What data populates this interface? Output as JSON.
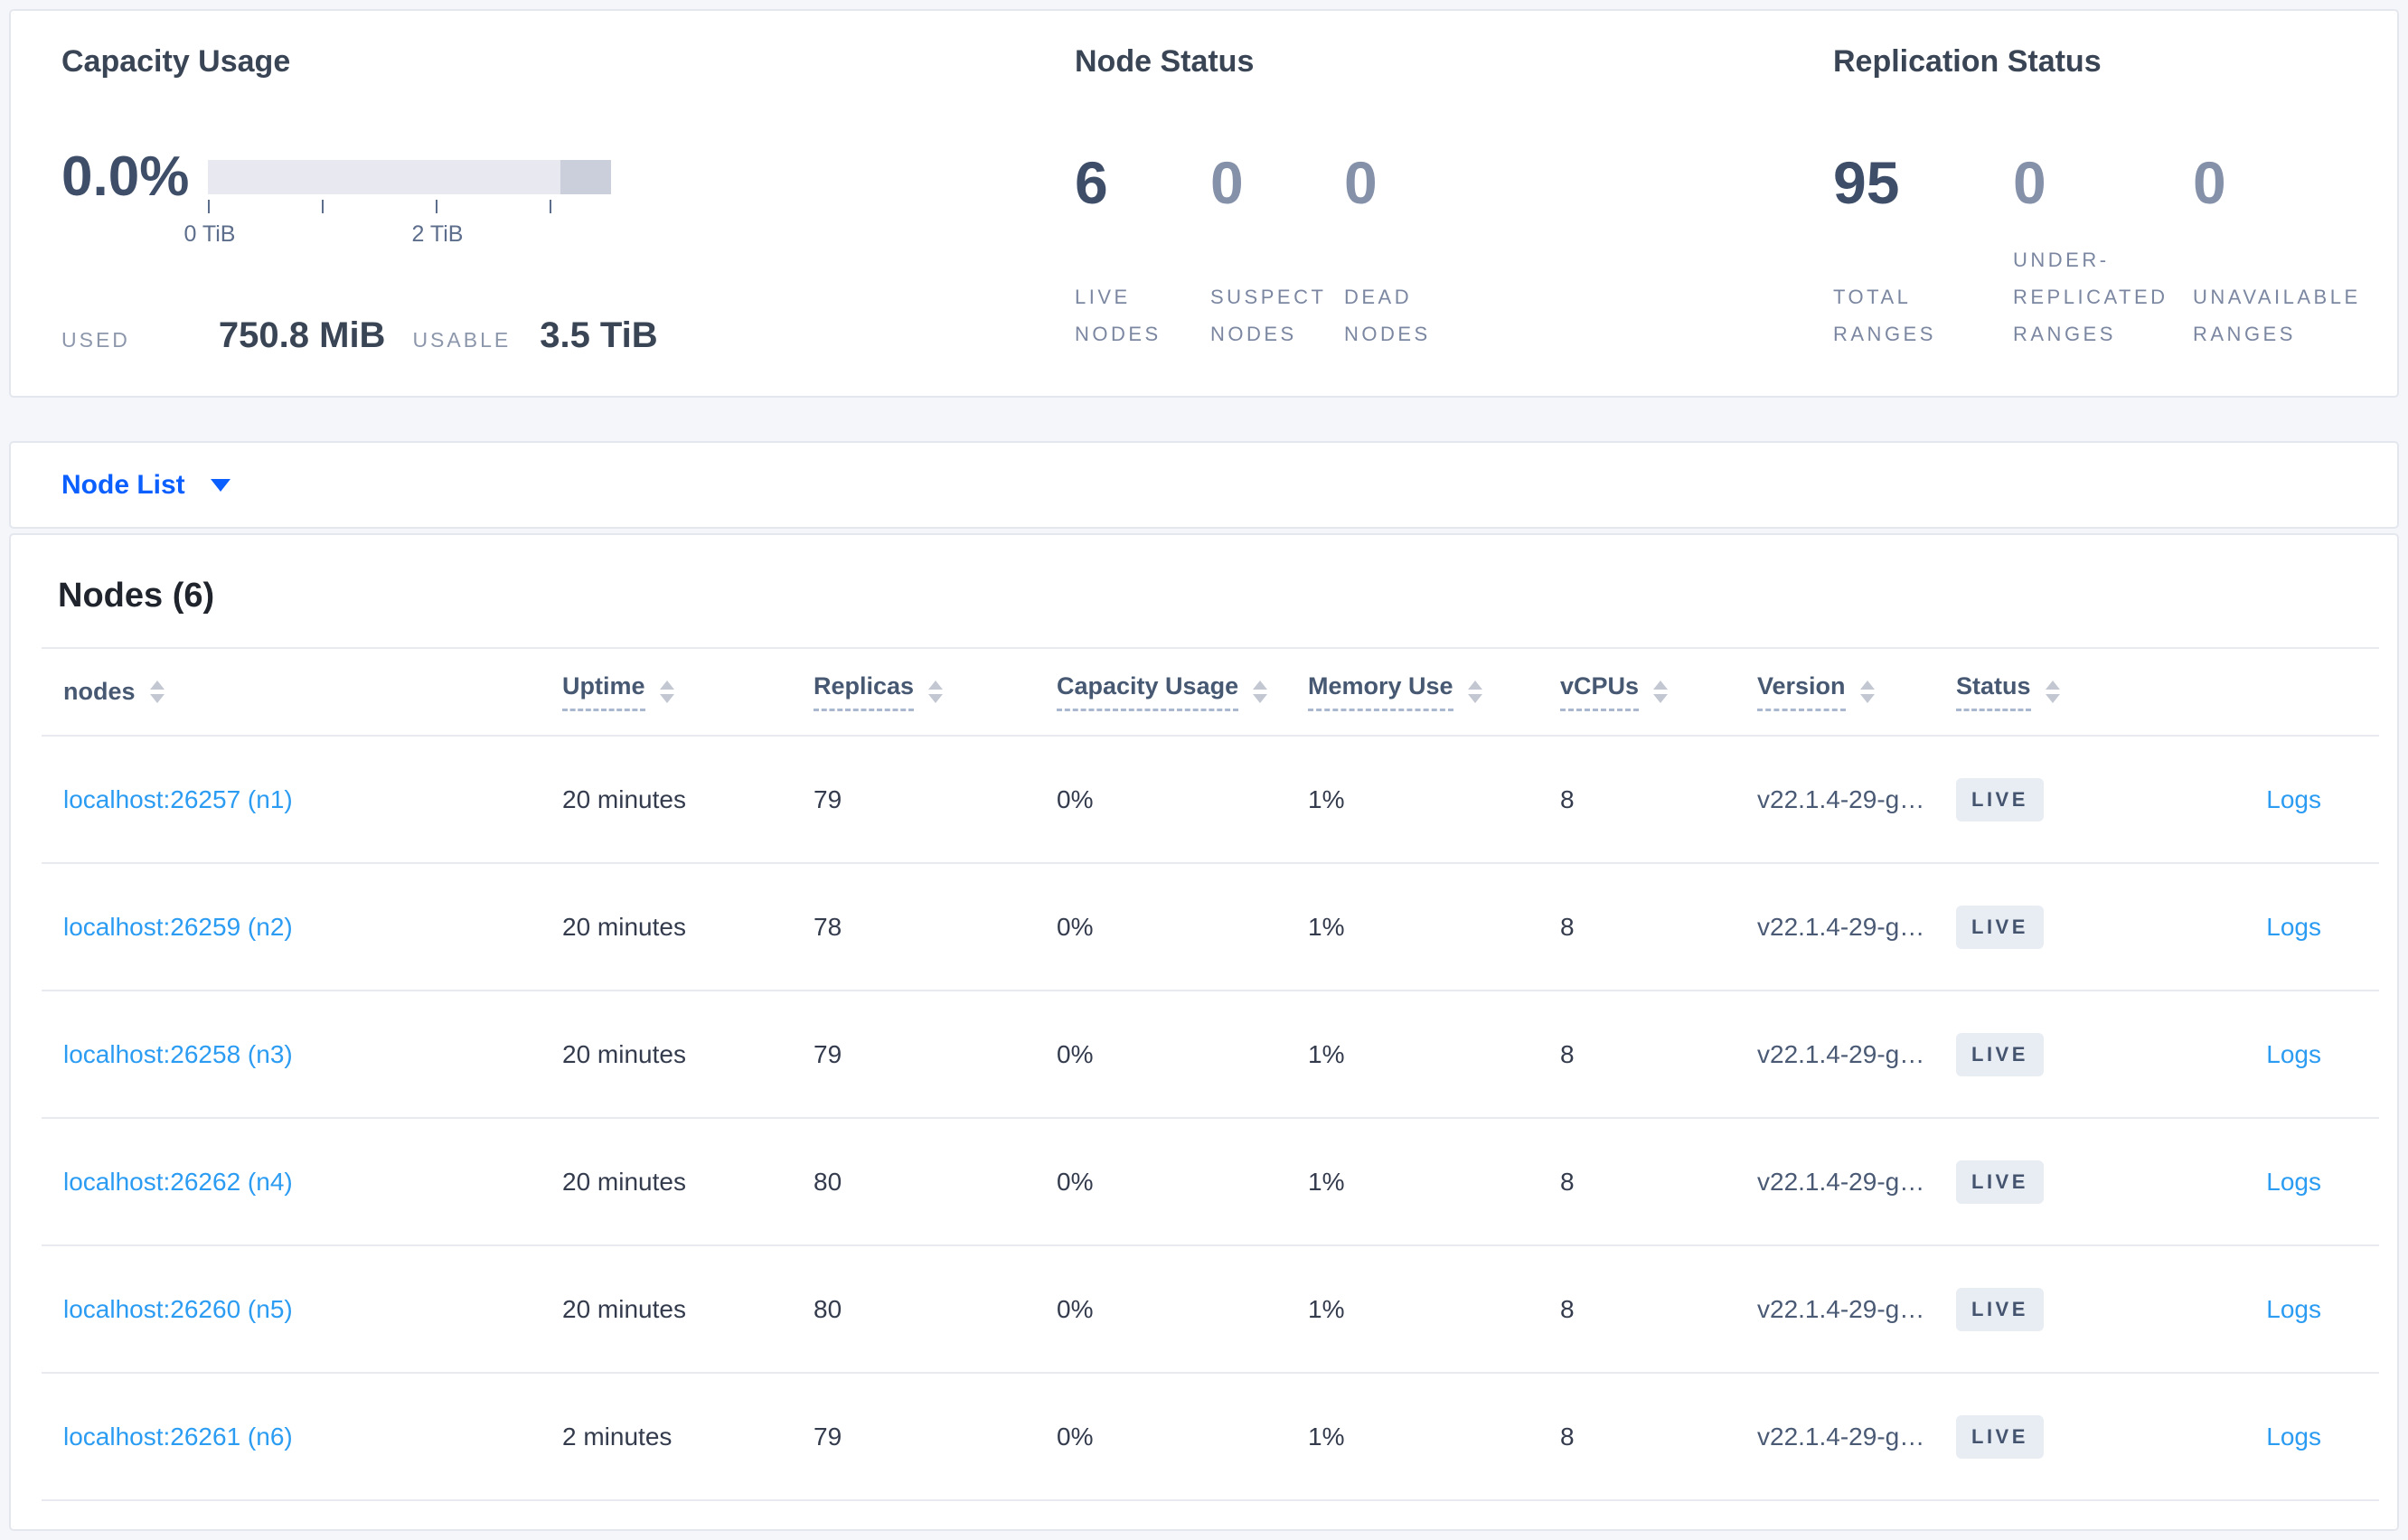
{
  "theme": {
    "page_bg": "#f4f6fa",
    "primary_blue": "#0b5fff",
    "link_blue": "#2b9cf2",
    "badge_bg": "#e8ecf3",
    "badge_text": "#44536e",
    "bar_track": "#e7e8f0",
    "bar_cap": "#cbcfdc"
  },
  "summary": {
    "capacity": {
      "title": "Capacity Usage",
      "percent": "0.0%",
      "axis_ticks": [
        "0 TiB",
        "2 TiB"
      ],
      "used_label": "USED",
      "used_value": "750.8 MiB",
      "usable_label": "USABLE",
      "usable_value": "3.5 TiB",
      "bar": {
        "used_fraction": 0.0,
        "cap_fraction": 0.125,
        "usable": "3.5 TiB",
        "total_tib": 4
      }
    },
    "node_status": {
      "title": "Node Status",
      "metrics": [
        {
          "value": "6",
          "label": "LIVE NODES"
        },
        {
          "value": "0",
          "label": "SUSPECT NODES"
        },
        {
          "value": "0",
          "label": "DEAD NODES"
        }
      ]
    },
    "replication": {
      "title": "Replication Status",
      "metrics": [
        {
          "value": "95",
          "label": "TOTAL RANGES"
        },
        {
          "value": "0",
          "label": "UNDER-REPLICATED RANGES"
        },
        {
          "value": "0",
          "label": "UNAVAILABLE RANGES"
        }
      ]
    }
  },
  "view_selector": {
    "label": "Node List"
  },
  "nodes_table": {
    "title": "Nodes (6)",
    "columns": [
      "nodes",
      "Uptime",
      "Replicas",
      "Capacity Usage",
      "Memory Use",
      "vCPUs",
      "Version",
      "Status"
    ],
    "logs_label": "Logs",
    "rows": [
      {
        "node": "localhost:26257 (n1)",
        "uptime": "20 minutes",
        "replicas": "79",
        "capacity_usage": "0%",
        "memory_use": "1%",
        "vcpus": "8",
        "version": "v22.1.4-29-g…",
        "status": "LIVE"
      },
      {
        "node": "localhost:26259 (n2)",
        "uptime": "20 minutes",
        "replicas": "78",
        "capacity_usage": "0%",
        "memory_use": "1%",
        "vcpus": "8",
        "version": "v22.1.4-29-g…",
        "status": "LIVE"
      },
      {
        "node": "localhost:26258 (n3)",
        "uptime": "20 minutes",
        "replicas": "79",
        "capacity_usage": "0%",
        "memory_use": "1%",
        "vcpus": "8",
        "version": "v22.1.4-29-g…",
        "status": "LIVE"
      },
      {
        "node": "localhost:26262 (n4)",
        "uptime": "20 minutes",
        "replicas": "80",
        "capacity_usage": "0%",
        "memory_use": "1%",
        "vcpus": "8",
        "version": "v22.1.4-29-g…",
        "status": "LIVE"
      },
      {
        "node": "localhost:26260 (n5)",
        "uptime": "20 minutes",
        "replicas": "80",
        "capacity_usage": "0%",
        "memory_use": "1%",
        "vcpus": "8",
        "version": "v22.1.4-29-g…",
        "status": "LIVE"
      },
      {
        "node": "localhost:26261 (n6)",
        "uptime": "2 minutes",
        "replicas": "79",
        "capacity_usage": "0%",
        "memory_use": "1%",
        "vcpus": "8",
        "version": "v22.1.4-29-g…",
        "status": "LIVE"
      }
    ]
  }
}
